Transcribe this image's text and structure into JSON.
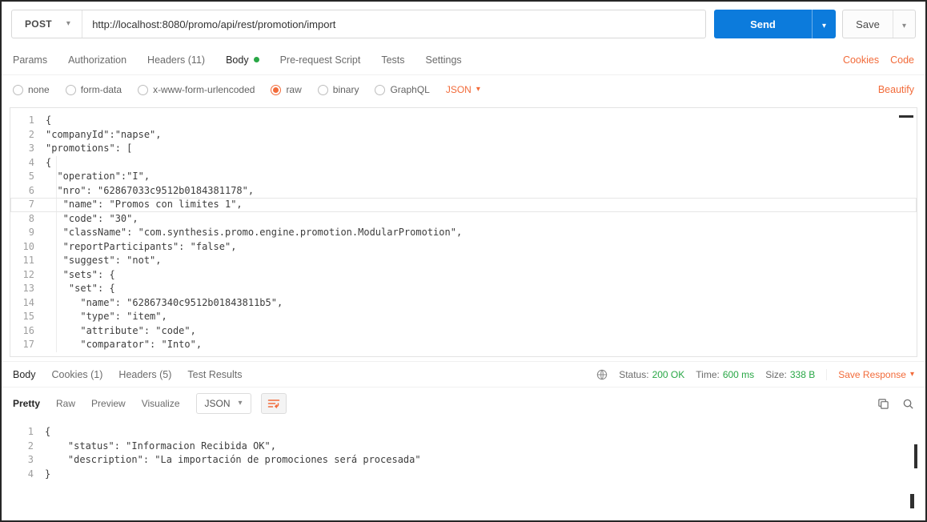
{
  "request": {
    "method": "POST",
    "url": "http://localhost:8080/promo/api/rest/promotion/import",
    "send_label": "Send",
    "save_label": "Save"
  },
  "request_tabs": {
    "items": [
      "Params",
      "Authorization",
      "Headers (11)",
      "Body",
      "Pre-request Script",
      "Tests",
      "Settings"
    ],
    "cookies_link": "Cookies",
    "code_link": "Code"
  },
  "body_type_bar": {
    "options": [
      "none",
      "form-data",
      "x-www-form-urlencoded",
      "raw",
      "binary",
      "GraphQL"
    ],
    "selected_option": "raw",
    "language_selector": "JSON",
    "beautify_link": "Beautify"
  },
  "request_editor": {
    "lines": [
      {
        "num": "1",
        "text": "{"
      },
      {
        "num": "2",
        "text": "\"companyId\":\"napse\","
      },
      {
        "num": "3",
        "text": "\"promotions\": ["
      },
      {
        "num": "4",
        "text": "{"
      },
      {
        "num": "5",
        "text": "  \"operation\":\"I\","
      },
      {
        "num": "6",
        "text": "  \"nro\": \"62867033c9512b0184381178\","
      },
      {
        "num": "7",
        "text": "   \"name\": \"Promos con limites 1\","
      },
      {
        "num": "8",
        "text": "   \"code\": \"30\","
      },
      {
        "num": "9",
        "text": "   \"className\": \"com.synthesis.promo.engine.promotion.ModularPromotion\","
      },
      {
        "num": "10",
        "text": "   \"reportParticipants\": \"false\","
      },
      {
        "num": "11",
        "text": "   \"suggest\": \"not\","
      },
      {
        "num": "12",
        "text": "   \"sets\": {"
      },
      {
        "num": "13",
        "text": "    \"set\": {"
      },
      {
        "num": "14",
        "text": "      \"name\": \"62867340c9512b01843811b5\","
      },
      {
        "num": "15",
        "text": "      \"type\": \"item\","
      },
      {
        "num": "16",
        "text": "      \"attribute\": \"code\","
      },
      {
        "num": "17",
        "text": "      \"comparator\": \"Into\","
      }
    ]
  },
  "response": {
    "tabs": [
      "Body",
      "Cookies (1)",
      "Headers (5)",
      "Test Results"
    ],
    "status_label": "Status:",
    "status_value": "200 OK",
    "time_label": "Time:",
    "time_value": "600 ms",
    "size_label": "Size:",
    "size_value": "338 B",
    "save_response_label": "Save Response",
    "view_tabs": [
      "Pretty",
      "Raw",
      "Preview",
      "Visualize"
    ],
    "language_selector": "JSON"
  },
  "response_editor": {
    "lines": [
      {
        "num": "1",
        "text": "{"
      },
      {
        "num": "2",
        "text": "    \"status\": \"Informacion Recibida OK\","
      },
      {
        "num": "3",
        "text": "    \"description\": \"La importación de promociones será procesada\""
      },
      {
        "num": "4",
        "text": "}"
      }
    ]
  },
  "colors": {
    "accent_orange": "#f26b3a",
    "send_blue": "#0c7bdc",
    "status_green": "#29a746"
  }
}
